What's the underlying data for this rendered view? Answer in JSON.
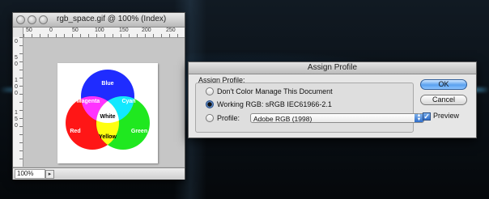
{
  "document_window": {
    "title": "rgb_space.gif @ 100% (Index)",
    "ruler_top_labels": [
      "50",
      "0",
      "50",
      "100",
      "150",
      "200",
      "250"
    ],
    "ruler_left_labels": [
      "0",
      "5",
      "0",
      "1",
      "0",
      "0",
      "1",
      "5",
      "0"
    ],
    "zoom": "100%",
    "image": {
      "circles": [
        {
          "name": "Blue",
          "color": "#1f2cff"
        },
        {
          "name": "Red",
          "color": "#ff1616"
        },
        {
          "name": "Green",
          "color": "#1fe81f"
        }
      ],
      "overlaps": [
        {
          "name": "Magenta",
          "color": "#ff33ff"
        },
        {
          "name": "Cyan",
          "color": "#12e8ff"
        },
        {
          "name": "Yellow",
          "color": "#ffff10"
        },
        {
          "name": "White",
          "color": "#ffffff"
        }
      ]
    }
  },
  "dialog": {
    "title": "Assign Profile",
    "group_label": "Assign Profile:",
    "options": [
      {
        "label": "Don't Color Manage This Document",
        "selected": false
      },
      {
        "label": "Working RGB:  sRGB IEC61966-2.1",
        "selected": true
      },
      {
        "label": "Profile:",
        "selected": false
      }
    ],
    "profile_value": "Adobe RGB (1998)",
    "ok_label": "OK",
    "cancel_label": "Cancel",
    "preview_label": "Preview",
    "preview_checked": true
  },
  "colors": {
    "accent_blue": "#3f86e0",
    "desktop_glow": "#5ac8ff"
  }
}
